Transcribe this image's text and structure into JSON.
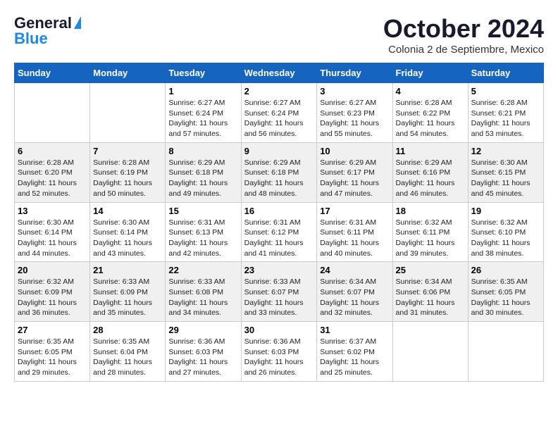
{
  "logo": {
    "line1": "General",
    "line2": "Blue"
  },
  "title": "October 2024",
  "location": "Colonia 2 de Septiembre, Mexico",
  "headers": [
    "Sunday",
    "Monday",
    "Tuesday",
    "Wednesday",
    "Thursday",
    "Friday",
    "Saturday"
  ],
  "weeks": [
    [
      {
        "day": "",
        "info": ""
      },
      {
        "day": "",
        "info": ""
      },
      {
        "day": "1",
        "info": "Sunrise: 6:27 AM\nSunset: 6:24 PM\nDaylight: 11 hours and 57 minutes."
      },
      {
        "day": "2",
        "info": "Sunrise: 6:27 AM\nSunset: 6:24 PM\nDaylight: 11 hours and 56 minutes."
      },
      {
        "day": "3",
        "info": "Sunrise: 6:27 AM\nSunset: 6:23 PM\nDaylight: 11 hours and 55 minutes."
      },
      {
        "day": "4",
        "info": "Sunrise: 6:28 AM\nSunset: 6:22 PM\nDaylight: 11 hours and 54 minutes."
      },
      {
        "day": "5",
        "info": "Sunrise: 6:28 AM\nSunset: 6:21 PM\nDaylight: 11 hours and 53 minutes."
      }
    ],
    [
      {
        "day": "6",
        "info": "Sunrise: 6:28 AM\nSunset: 6:20 PM\nDaylight: 11 hours and 52 minutes."
      },
      {
        "day": "7",
        "info": "Sunrise: 6:28 AM\nSunset: 6:19 PM\nDaylight: 11 hours and 50 minutes."
      },
      {
        "day": "8",
        "info": "Sunrise: 6:29 AM\nSunset: 6:18 PM\nDaylight: 11 hours and 49 minutes."
      },
      {
        "day": "9",
        "info": "Sunrise: 6:29 AM\nSunset: 6:18 PM\nDaylight: 11 hours and 48 minutes."
      },
      {
        "day": "10",
        "info": "Sunrise: 6:29 AM\nSunset: 6:17 PM\nDaylight: 11 hours and 47 minutes."
      },
      {
        "day": "11",
        "info": "Sunrise: 6:29 AM\nSunset: 6:16 PM\nDaylight: 11 hours and 46 minutes."
      },
      {
        "day": "12",
        "info": "Sunrise: 6:30 AM\nSunset: 6:15 PM\nDaylight: 11 hours and 45 minutes."
      }
    ],
    [
      {
        "day": "13",
        "info": "Sunrise: 6:30 AM\nSunset: 6:14 PM\nDaylight: 11 hours and 44 minutes."
      },
      {
        "day": "14",
        "info": "Sunrise: 6:30 AM\nSunset: 6:14 PM\nDaylight: 11 hours and 43 minutes."
      },
      {
        "day": "15",
        "info": "Sunrise: 6:31 AM\nSunset: 6:13 PM\nDaylight: 11 hours and 42 minutes."
      },
      {
        "day": "16",
        "info": "Sunrise: 6:31 AM\nSunset: 6:12 PM\nDaylight: 11 hours and 41 minutes."
      },
      {
        "day": "17",
        "info": "Sunrise: 6:31 AM\nSunset: 6:11 PM\nDaylight: 11 hours and 40 minutes."
      },
      {
        "day": "18",
        "info": "Sunrise: 6:32 AM\nSunset: 6:11 PM\nDaylight: 11 hours and 39 minutes."
      },
      {
        "day": "19",
        "info": "Sunrise: 6:32 AM\nSunset: 6:10 PM\nDaylight: 11 hours and 38 minutes."
      }
    ],
    [
      {
        "day": "20",
        "info": "Sunrise: 6:32 AM\nSunset: 6:09 PM\nDaylight: 11 hours and 36 minutes."
      },
      {
        "day": "21",
        "info": "Sunrise: 6:33 AM\nSunset: 6:09 PM\nDaylight: 11 hours and 35 minutes."
      },
      {
        "day": "22",
        "info": "Sunrise: 6:33 AM\nSunset: 6:08 PM\nDaylight: 11 hours and 34 minutes."
      },
      {
        "day": "23",
        "info": "Sunrise: 6:33 AM\nSunset: 6:07 PM\nDaylight: 11 hours and 33 minutes."
      },
      {
        "day": "24",
        "info": "Sunrise: 6:34 AM\nSunset: 6:07 PM\nDaylight: 11 hours and 32 minutes."
      },
      {
        "day": "25",
        "info": "Sunrise: 6:34 AM\nSunset: 6:06 PM\nDaylight: 11 hours and 31 minutes."
      },
      {
        "day": "26",
        "info": "Sunrise: 6:35 AM\nSunset: 6:05 PM\nDaylight: 11 hours and 30 minutes."
      }
    ],
    [
      {
        "day": "27",
        "info": "Sunrise: 6:35 AM\nSunset: 6:05 PM\nDaylight: 11 hours and 29 minutes."
      },
      {
        "day": "28",
        "info": "Sunrise: 6:35 AM\nSunset: 6:04 PM\nDaylight: 11 hours and 28 minutes."
      },
      {
        "day": "29",
        "info": "Sunrise: 6:36 AM\nSunset: 6:03 PM\nDaylight: 11 hours and 27 minutes."
      },
      {
        "day": "30",
        "info": "Sunrise: 6:36 AM\nSunset: 6:03 PM\nDaylight: 11 hours and 26 minutes."
      },
      {
        "day": "31",
        "info": "Sunrise: 6:37 AM\nSunset: 6:02 PM\nDaylight: 11 hours and 25 minutes."
      },
      {
        "day": "",
        "info": ""
      },
      {
        "day": "",
        "info": ""
      }
    ]
  ]
}
